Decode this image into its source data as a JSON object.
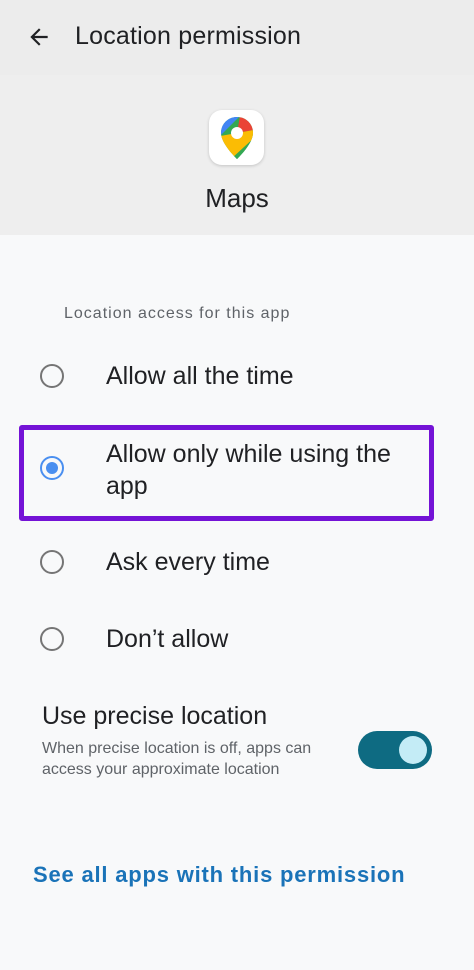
{
  "topbar": {
    "back_icon": "arrow-left-icon",
    "title": "Location permission"
  },
  "app": {
    "icon": "google-maps-icon",
    "name": "Maps"
  },
  "section": {
    "label": "Location access for this app"
  },
  "options": [
    {
      "label": "Allow all the time",
      "selected": false
    },
    {
      "label": "Allow only while using the app",
      "selected": true
    },
    {
      "label": "Ask every time",
      "selected": false
    },
    {
      "label": "Don’t allow",
      "selected": false
    }
  ],
  "precise": {
    "title": "Use precise location",
    "description": "When precise location is off, apps can access your approximate location",
    "enabled": true
  },
  "footer": {
    "link_label": "See all apps with this permission"
  },
  "colors": {
    "accent_radio": "#4a8ff0",
    "toggle_track": "#0e6b82",
    "link": "#1a73b8",
    "highlight": "#7413d6"
  }
}
